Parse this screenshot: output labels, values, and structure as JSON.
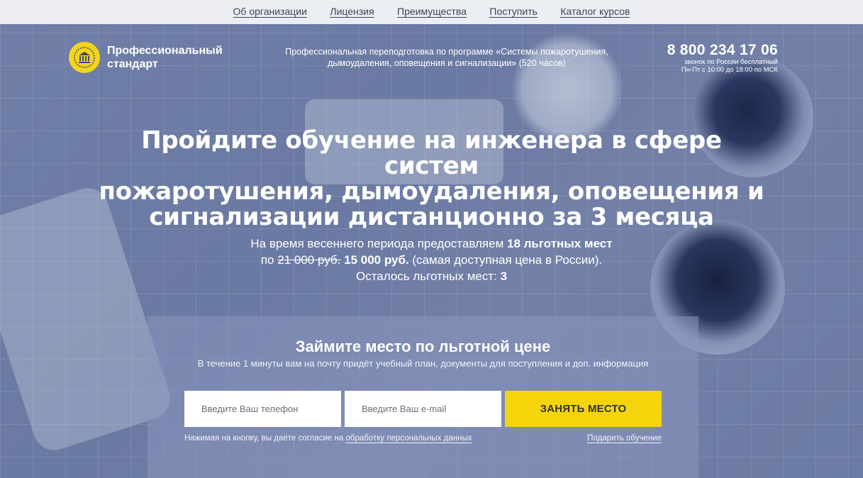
{
  "nav": {
    "items": [
      {
        "label": "Об организации"
      },
      {
        "label": "Лицензия"
      },
      {
        "label": "Преимущества"
      },
      {
        "label": "Поступить"
      },
      {
        "label": "Каталог курсов"
      }
    ]
  },
  "logo": {
    "icon": "building-icon",
    "line1": "Профессиональный",
    "line2": "стандарт",
    "color": "#f2d51a"
  },
  "program": {
    "line1": "Профессиональная переподготовка по программе «Системы пожаротушения,",
    "line2": "дымоудаления, оповещения и сигнализации» (520 часов)"
  },
  "contact": {
    "phone": "8 800 234 17 06",
    "note1": "звонок по России бесплатный",
    "note2": "Пн-Пт с 10:00 до 18:00 по МСК"
  },
  "hero": {
    "headline_line1": "Пройдите обучение на инженера в сфере систем",
    "headline_line2": "пожаротушения, дымоудаления, оповещения и",
    "headline_line3": "сигнализации дистанционно за 3 месяца",
    "offer_prefix": "На время весеннего периода предоставляем ",
    "offer_seats": "18 льготных мест",
    "offer_by": " по ",
    "old_price": "21 000 руб.",
    "new_price": "15 000 руб.",
    "offer_suffix": " (самая доступная цена в России).",
    "remaining_label": "Осталось льготных мест: ",
    "remaining_count": "3"
  },
  "form": {
    "title": "Займите место по льготной цене",
    "subtitle": "В течение 1 минуты вам на почту придёт учебный план, документы для поступления и доп. информация",
    "phone_placeholder": "Введите Ваш телефон",
    "email_placeholder": "Введите Ваш e-mail",
    "submit_label": "ЗАНЯТЬ МЕСТО",
    "submit_color": "#f6d40c",
    "agree_prefix": "Нажимая на кнопку, вы даёте согласие на ",
    "agree_link": "обработку персональных данных",
    "gift_link": "Подарить обучение"
  }
}
